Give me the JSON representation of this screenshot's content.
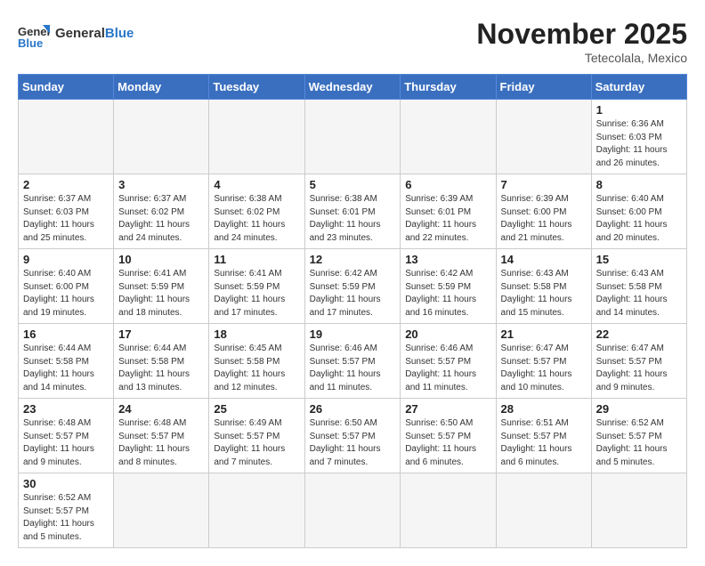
{
  "header": {
    "logo_general": "General",
    "logo_blue": "Blue",
    "month_title": "November 2025",
    "location": "Tetecolala, Mexico"
  },
  "weekdays": [
    "Sunday",
    "Monday",
    "Tuesday",
    "Wednesday",
    "Thursday",
    "Friday",
    "Saturday"
  ],
  "weeks": [
    [
      {
        "day": "",
        "empty": true
      },
      {
        "day": "",
        "empty": true
      },
      {
        "day": "",
        "empty": true
      },
      {
        "day": "",
        "empty": true
      },
      {
        "day": "",
        "empty": true
      },
      {
        "day": "",
        "empty": true
      },
      {
        "day": "1",
        "sunrise": "6:36 AM",
        "sunset": "6:03 PM",
        "daylight": "11 hours and 26 minutes."
      }
    ],
    [
      {
        "day": "2",
        "sunrise": "6:37 AM",
        "sunset": "6:03 PM",
        "daylight": "11 hours and 25 minutes."
      },
      {
        "day": "3",
        "sunrise": "6:37 AM",
        "sunset": "6:02 PM",
        "daylight": "11 hours and 24 minutes."
      },
      {
        "day": "4",
        "sunrise": "6:38 AM",
        "sunset": "6:02 PM",
        "daylight": "11 hours and 24 minutes."
      },
      {
        "day": "5",
        "sunrise": "6:38 AM",
        "sunset": "6:01 PM",
        "daylight": "11 hours and 23 minutes."
      },
      {
        "day": "6",
        "sunrise": "6:39 AM",
        "sunset": "6:01 PM",
        "daylight": "11 hours and 22 minutes."
      },
      {
        "day": "7",
        "sunrise": "6:39 AM",
        "sunset": "6:00 PM",
        "daylight": "11 hours and 21 minutes."
      },
      {
        "day": "8",
        "sunrise": "6:40 AM",
        "sunset": "6:00 PM",
        "daylight": "11 hours and 20 minutes."
      }
    ],
    [
      {
        "day": "9",
        "sunrise": "6:40 AM",
        "sunset": "6:00 PM",
        "daylight": "11 hours and 19 minutes."
      },
      {
        "day": "10",
        "sunrise": "6:41 AM",
        "sunset": "5:59 PM",
        "daylight": "11 hours and 18 minutes."
      },
      {
        "day": "11",
        "sunrise": "6:41 AM",
        "sunset": "5:59 PM",
        "daylight": "11 hours and 17 minutes."
      },
      {
        "day": "12",
        "sunrise": "6:42 AM",
        "sunset": "5:59 PM",
        "daylight": "11 hours and 17 minutes."
      },
      {
        "day": "13",
        "sunrise": "6:42 AM",
        "sunset": "5:59 PM",
        "daylight": "11 hours and 16 minutes."
      },
      {
        "day": "14",
        "sunrise": "6:43 AM",
        "sunset": "5:58 PM",
        "daylight": "11 hours and 15 minutes."
      },
      {
        "day": "15",
        "sunrise": "6:43 AM",
        "sunset": "5:58 PM",
        "daylight": "11 hours and 14 minutes."
      }
    ],
    [
      {
        "day": "16",
        "sunrise": "6:44 AM",
        "sunset": "5:58 PM",
        "daylight": "11 hours and 14 minutes."
      },
      {
        "day": "17",
        "sunrise": "6:44 AM",
        "sunset": "5:58 PM",
        "daylight": "11 hours and 13 minutes."
      },
      {
        "day": "18",
        "sunrise": "6:45 AM",
        "sunset": "5:58 PM",
        "daylight": "11 hours and 12 minutes."
      },
      {
        "day": "19",
        "sunrise": "6:46 AM",
        "sunset": "5:57 PM",
        "daylight": "11 hours and 11 minutes."
      },
      {
        "day": "20",
        "sunrise": "6:46 AM",
        "sunset": "5:57 PM",
        "daylight": "11 hours and 11 minutes."
      },
      {
        "day": "21",
        "sunrise": "6:47 AM",
        "sunset": "5:57 PM",
        "daylight": "11 hours and 10 minutes."
      },
      {
        "day": "22",
        "sunrise": "6:47 AM",
        "sunset": "5:57 PM",
        "daylight": "11 hours and 9 minutes."
      }
    ],
    [
      {
        "day": "23",
        "sunrise": "6:48 AM",
        "sunset": "5:57 PM",
        "daylight": "11 hours and 9 minutes."
      },
      {
        "day": "24",
        "sunrise": "6:48 AM",
        "sunset": "5:57 PM",
        "daylight": "11 hours and 8 minutes."
      },
      {
        "day": "25",
        "sunrise": "6:49 AM",
        "sunset": "5:57 PM",
        "daylight": "11 hours and 7 minutes."
      },
      {
        "day": "26",
        "sunrise": "6:50 AM",
        "sunset": "5:57 PM",
        "daylight": "11 hours and 7 minutes."
      },
      {
        "day": "27",
        "sunrise": "6:50 AM",
        "sunset": "5:57 PM",
        "daylight": "11 hours and 6 minutes."
      },
      {
        "day": "28",
        "sunrise": "6:51 AM",
        "sunset": "5:57 PM",
        "daylight": "11 hours and 6 minutes."
      },
      {
        "day": "29",
        "sunrise": "6:52 AM",
        "sunset": "5:57 PM",
        "daylight": "11 hours and 5 minutes."
      }
    ],
    [
      {
        "day": "30",
        "sunrise": "6:52 AM",
        "sunset": "5:57 PM",
        "daylight": "11 hours and 5 minutes."
      },
      {
        "day": "",
        "empty": true
      },
      {
        "day": "",
        "empty": true
      },
      {
        "day": "",
        "empty": true
      },
      {
        "day": "",
        "empty": true
      },
      {
        "day": "",
        "empty": true
      },
      {
        "day": "",
        "empty": true
      }
    ]
  ]
}
